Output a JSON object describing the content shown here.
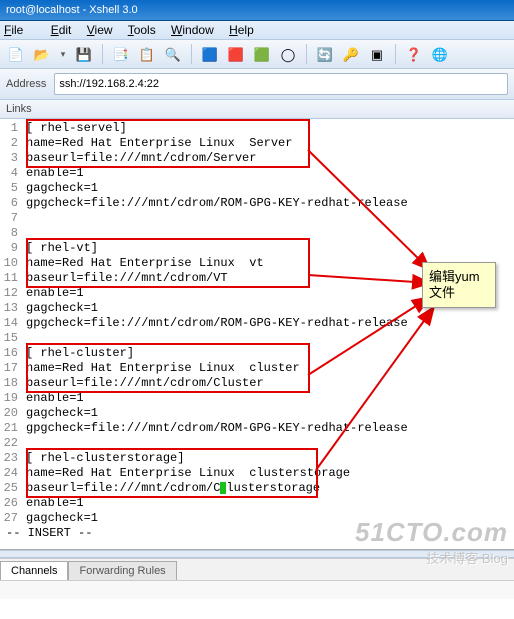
{
  "titlebar": {
    "text": "root@localhost - Xshell 3.0"
  },
  "menubar": {
    "file": "File",
    "edit": "Edit",
    "view": "View",
    "tools": "Tools",
    "window": "Window",
    "help": "Help"
  },
  "toolbar_icons": {
    "new": "📄",
    "open": "📂",
    "dropdown": "▾",
    "save": "💾",
    "copy": "📑",
    "paste": "📋",
    "find": "🔍",
    "bluebox": "🟦",
    "redbox": "🟥",
    "greenbox": "🟩",
    "circle": "◯",
    "refresh": "🔄",
    "key": "🔑",
    "prompt": "▣",
    "help": "❓",
    "globe": "🌐"
  },
  "addressbar": {
    "label": "Address",
    "value": "ssh://192.168.2.4:22"
  },
  "linksbar": {
    "label": "Links"
  },
  "callout": {
    "line1": "编辑yum",
    "line2": "文件"
  },
  "editor": {
    "lines": [
      "[ rhel-servel]",
      "name=Red Hat Enterprise Linux  Server",
      "baseurl=file:///mnt/cdrom/Server",
      "enable=1",
      "gagcheck=1",
      "gpgcheck=file:///mnt/cdrom/ROM-GPG-KEY-redhat-release",
      "",
      "",
      "[ rhel-vt]",
      "name=Red Hat Enterprise Linux  vt",
      "baseurl=file:///mnt/cdrom/VT",
      "enable=1",
      "gagcheck=1",
      "gpgcheck=file:///mnt/cdrom/ROM-GPG-KEY-redhat-release",
      "",
      "[ rhel-cluster]",
      "name=Red Hat Enterprise Linux  cluster",
      "baseurl=file:///mnt/cdrom/Cluster",
      "enable=1",
      "gagcheck=1",
      "gpgcheck=file:///mnt/cdrom/ROM-GPG-KEY-redhat-release",
      "",
      "[ rhel-clusterstorage]",
      "name=Red Hat Enterprise Linux  clusterstorage",
      "baseurl=file:///mnt/cdrom/Clusterstorage",
      "enable=1",
      "gagcheck=1"
    ],
    "insert": "-- INSERT --"
  },
  "cursor_line_index": 24,
  "cursor_col": 27,
  "tabs": {
    "channels": "Channels",
    "forwarding": "Forwarding Rules"
  },
  "watermark": {
    "big": "51CTO.com",
    "small": "技术博客  Blog"
  }
}
